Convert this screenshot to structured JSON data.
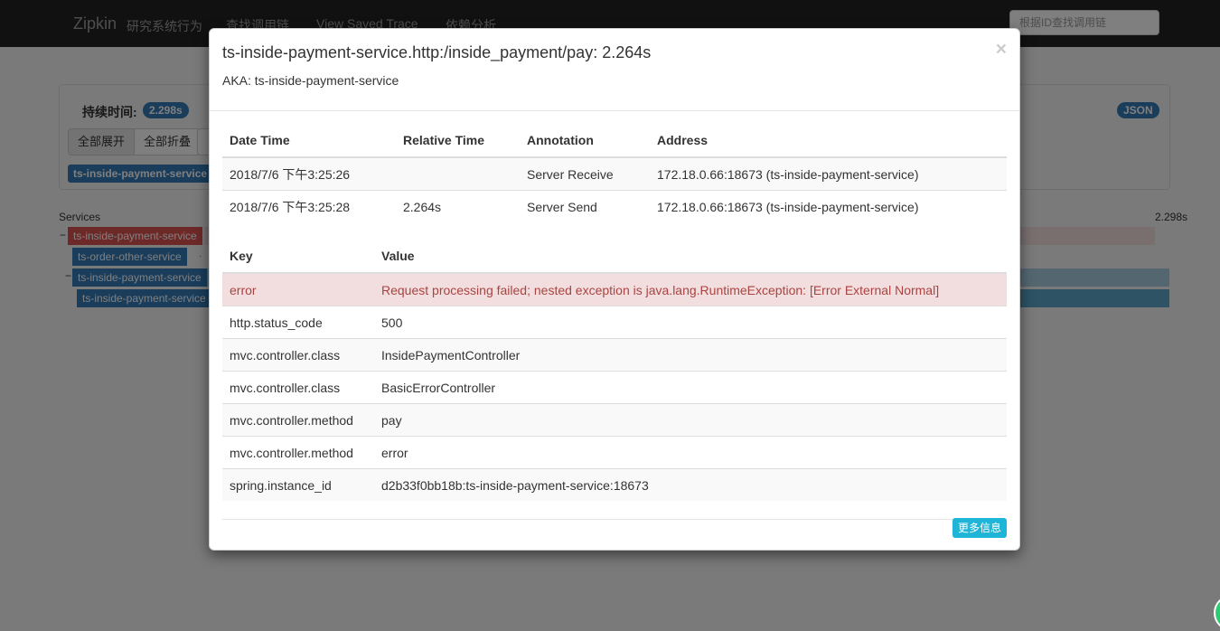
{
  "navbar": {
    "brand": "Zipkin",
    "brand_sub": "研究系统行为",
    "links": [
      "查找调用链",
      "View Saved Trace",
      "依赖分析"
    ],
    "search_placeholder": "根据ID查找调用链"
  },
  "summary": {
    "duration_label": "持续时间:",
    "duration_value": "2.298s",
    "json_label": "JSON",
    "expand_all": "全部展开",
    "collapse_all": "全部折叠",
    "service_chip": "ts-inside-payment-service"
  },
  "timeline": {
    "services_header": "Services",
    "duration_header": "2.298s",
    "rows": [
      {
        "toggle": "−",
        "label": "ts-inside-payment-service",
        "color": "#d9534f"
      },
      {
        "toggle": "",
        "label": "ts-order-other-service",
        "color": "#337ab7"
      },
      {
        "toggle": "−",
        "label": "ts-inside-payment-service",
        "color": "#337ab7"
      },
      {
        "toggle": "",
        "label": "ts-inside-payment-service",
        "color": "#337ab7"
      }
    ]
  },
  "modal": {
    "title": "ts-inside-payment-service.http:/inside_payment/pay: 2.264s",
    "aka_label": "AKA:",
    "aka_value": "ts-inside-payment-service",
    "close": "×",
    "annotations": {
      "headers": [
        "Date Time",
        "Relative Time",
        "Annotation",
        "Address"
      ],
      "rows": [
        {
          "date_time": "2018/7/6 下午3:25:26",
          "relative_time": "",
          "annotation": "Server Receive",
          "address": "172.18.0.66:18673 (ts-inside-payment-service)"
        },
        {
          "date_time": "2018/7/6 下午3:25:28",
          "relative_time": "2.264s",
          "annotation": "Server Send",
          "address": "172.18.0.66:18673 (ts-inside-payment-service)"
        }
      ]
    },
    "tags": {
      "headers": [
        "Key",
        "Value"
      ],
      "rows": [
        {
          "key": "error",
          "value": "Request processing failed; nested exception is java.lang.RuntimeException: [Error External Normal]"
        },
        {
          "key": "http.status_code",
          "value": "500"
        },
        {
          "key": "mvc.controller.class",
          "value": "InsidePaymentController"
        },
        {
          "key": "mvc.controller.class",
          "value": "BasicErrorController"
        },
        {
          "key": "mvc.controller.method",
          "value": "pay"
        },
        {
          "key": "mvc.controller.method",
          "value": "error"
        },
        {
          "key": "spring.instance_id",
          "value": "d2b33f0bb18b:ts-inside-payment-service:18673"
        }
      ]
    },
    "more_button": "更多信息"
  },
  "colors": {
    "navbar": "#222222",
    "primary": "#337ab7",
    "danger_bg": "#f2dede",
    "danger_text": "#a94442",
    "info_button": "#1fb5d6"
  }
}
